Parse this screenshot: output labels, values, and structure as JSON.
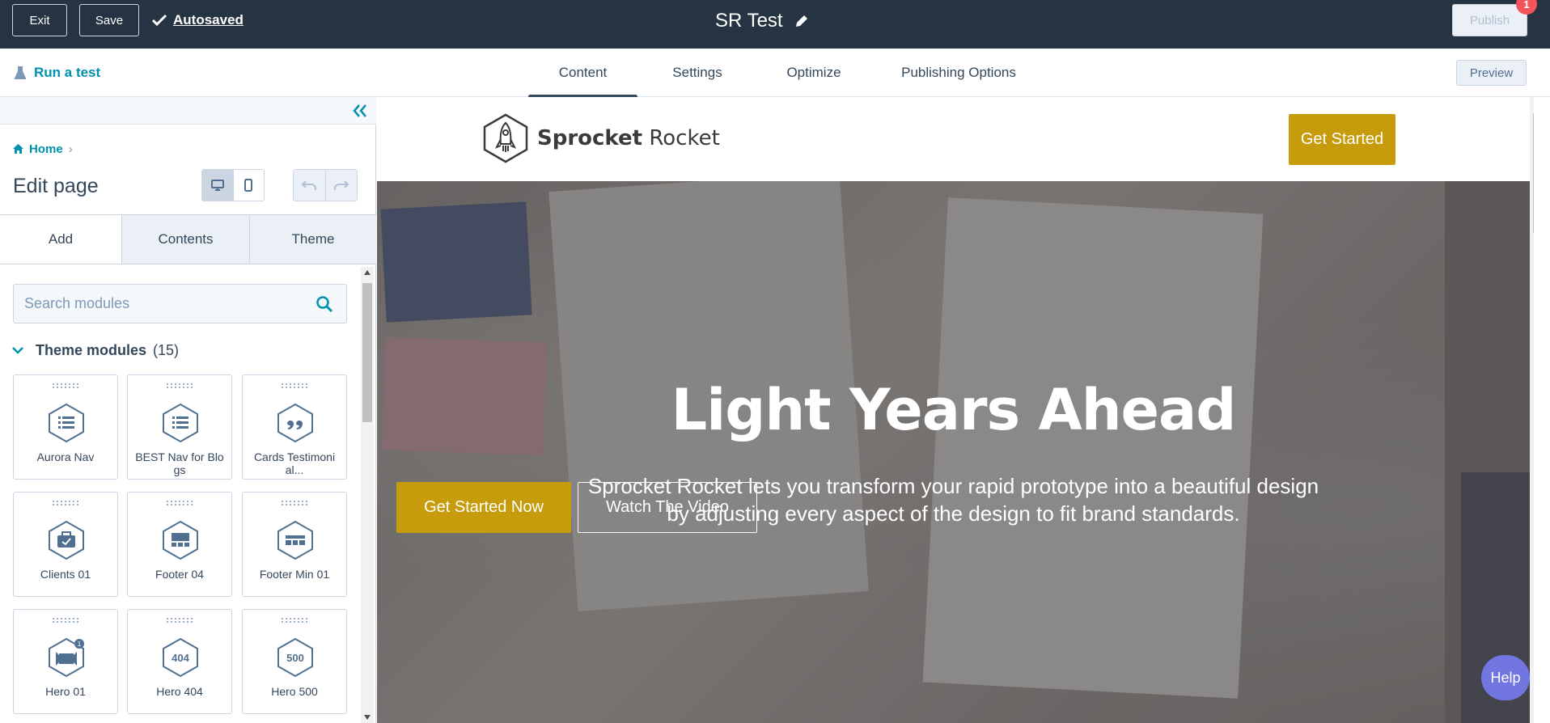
{
  "topbar": {
    "exit_label": "Exit",
    "save_label": "Save",
    "autosaved_label": "Autosaved",
    "page_title": "SR Test",
    "publish_label": "Publish",
    "notification_count": "1"
  },
  "subbar": {
    "run_test_label": "Run a test",
    "tabs": [
      {
        "label": "Content",
        "active": true
      },
      {
        "label": "Settings"
      },
      {
        "label": "Optimize"
      },
      {
        "label": "Publishing Options"
      }
    ],
    "preview_label": "Preview"
  },
  "sidebar": {
    "breadcrumb_home": "Home",
    "edit_title": "Edit page",
    "tabs": [
      "Add",
      "Contents",
      "Theme"
    ],
    "search_placeholder": "Search modules",
    "section_title": "Theme modules",
    "section_count": "(15)",
    "modules": [
      {
        "name": "Aurora Nav",
        "icon": "list-icon"
      },
      {
        "name": "BEST Nav for Blo gs",
        "icon": "list-icon"
      },
      {
        "name": "Cards Testimoni al...",
        "icon": "quote-icon"
      },
      {
        "name": "Clients 01",
        "icon": "briefcase-icon"
      },
      {
        "name": "Footer 04",
        "icon": "footer-icon"
      },
      {
        "name": "Footer Min 01",
        "icon": "footer-min-icon"
      },
      {
        "name": "Hero 01",
        "icon": "video-icon"
      },
      {
        "name": "Hero 404",
        "icon": "404-icon"
      },
      {
        "name": "Hero 500",
        "icon": "500-icon"
      }
    ]
  },
  "preview": {
    "brand_bold": "Sprocket",
    "brand_light": " Rocket",
    "header_cta": "Get Started",
    "hero_title": "Light Years Ahead",
    "hero_subtitle": "Sprocket Rocket lets you transform your rapid prototype into a beautiful design by adjusting every aspect of the design to fit brand standards.",
    "cta_primary": "Get Started Now",
    "cta_secondary": "Watch The Video"
  },
  "help_label": "Help",
  "colors": {
    "topbar_bg": "#253342",
    "accent_link": "#0091ae",
    "brand_gold": "#c69c0d",
    "help_purple": "#7176e0",
    "badge_red": "#f2545b"
  }
}
